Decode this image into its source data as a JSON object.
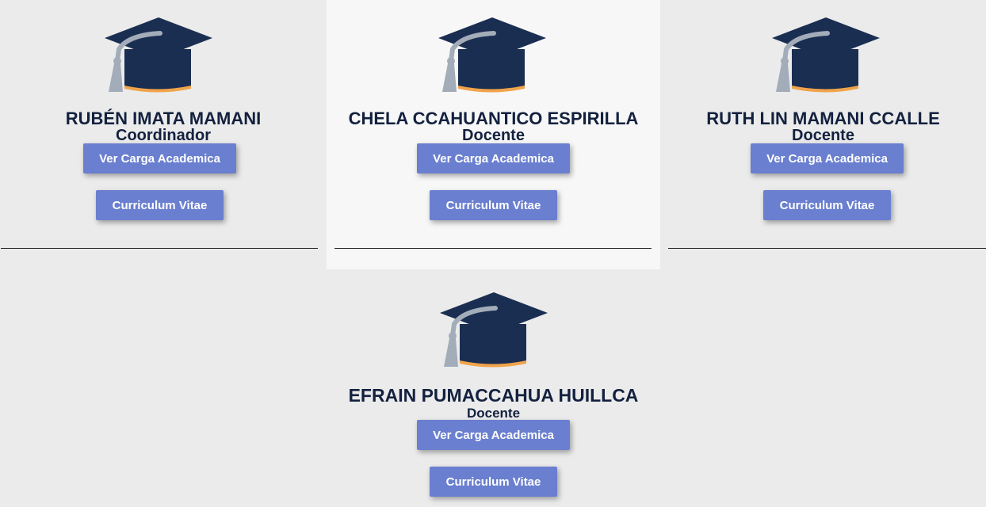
{
  "cards": [
    {
      "name": "RUBÉN IMATA MAMANI",
      "role": "Coordinador",
      "load_label": "Ver Carga Academica",
      "cv_label": "Curriculum Vitae"
    },
    {
      "name": "CHELA CCAHUANTICO ESPIRILLA",
      "role": "Docente",
      "load_label": "Ver Carga Academica",
      "cv_label": "Curriculum Vitae"
    },
    {
      "name": "RUTH LIN MAMANI CCALLE",
      "role": "Docente",
      "load_label": "Ver Carga Academica",
      "cv_label": "Curriculum Vitae"
    },
    {
      "name": "EFRAIN PUMACCAHUA HUILLCA",
      "role": "Docente",
      "load_label": "Ver Carga Academica",
      "cv_label": "Curriculum Vitae"
    }
  ],
  "icons": {
    "card_icon": "graduation-cap-icon"
  },
  "colors": {
    "name_text": "#13213f",
    "button_bg": "#6a7fcf",
    "cap_top": "#1a2e52",
    "cap_tassel": "#a3acb9",
    "cap_rim": "#f0a34a"
  }
}
